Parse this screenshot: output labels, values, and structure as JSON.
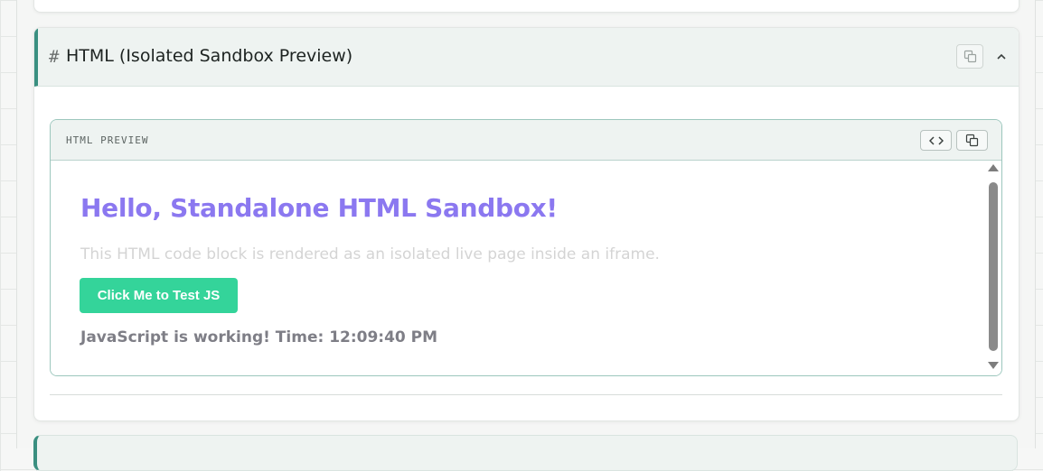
{
  "section": {
    "hash": "#",
    "title": "HTML (Isolated Sandbox Preview)"
  },
  "preview": {
    "label": "HTML PREVIEW"
  },
  "sandbox": {
    "heading": "Hello, Standalone HTML Sandbox!",
    "paragraph": "This HTML code block is rendered as an isolated live page inside an iframe.",
    "button_label": "Click Me to Test JS",
    "status": "JavaScript is working! Time: 12:09:40 PM"
  },
  "icons": {
    "copy": "copy-icon",
    "collapse": "chevron-up-icon",
    "code": "code-brackets-icon"
  },
  "colors": {
    "accent": "#3a8f80",
    "heading": "#8b78f0",
    "button": "#34d49a"
  }
}
